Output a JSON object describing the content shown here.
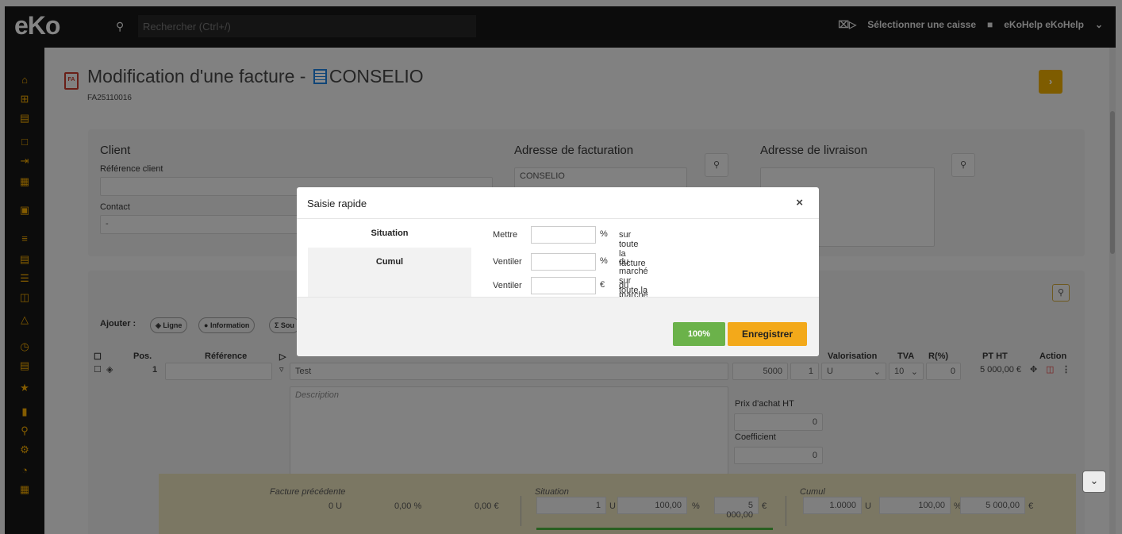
{
  "topbar": {
    "logo": "eKo",
    "search_placeholder": "Rechercher (Ctrl+/)",
    "cash_label": "Sélectionner une caisse",
    "user_label": "eKoHelp eKoHelp"
  },
  "page": {
    "title": "Modification d'une facture - ",
    "title_company": "CONSELIO",
    "subtitle": "FA25110016",
    "doc_badge": "FA"
  },
  "client": {
    "heading": "Client",
    "ref_label": "Référence client",
    "ref_value": "",
    "contact_label": "Contact",
    "contact_value": "-"
  },
  "billing": {
    "heading": "Adresse de facturation",
    "value": "CONSELIO"
  },
  "delivery": {
    "heading": "Adresse de livraison",
    "value": ""
  },
  "lines": {
    "add_label": "Ajouter :",
    "add_buttons": [
      "Ligne",
      "Information",
      "Sou"
    ],
    "columns": {
      "pos": "Pos.",
      "reference": "Référence",
      "valorisation": "Valorisation",
      "tva": "TVA",
      "r": "R(%)",
      "pt_ht": "PT HT",
      "action": "Action"
    },
    "row": {
      "pos": "1",
      "designation": "Test",
      "pu": "5000",
      "qty": "1",
      "unit": "U",
      "tva": "10",
      "r": "0",
      "pt_ht": "5 000,00 €",
      "description_placeholder": "Description",
      "purchase_label": "Prix d'achat HT",
      "purchase_value": "0",
      "coef_label": "Coefficient",
      "coef_value": "0"
    }
  },
  "summary": {
    "prev_label": "Facture précédente",
    "prev_qty": "0 U",
    "prev_pct": "0,00 %",
    "prev_amount": "0,00 €",
    "situation_label": "Situation",
    "situation_qty": "1",
    "situation_unit": "U",
    "situation_pct": "100,00",
    "situation_amount": "5 000,00",
    "cumul_label": "Cumul",
    "cumul_qty": "1.0000",
    "cumul_unit": "U",
    "cumul_pct": "100,00",
    "cumul_amount": "5 000,00",
    "pct_sym": "%",
    "eur_sym": "€"
  },
  "modal": {
    "title": "Saisie rapide",
    "close": "×",
    "tabs": [
      "Situation",
      "Cumul"
    ],
    "rows": [
      {
        "pre": "Mettre",
        "unit": "%",
        "post": "sur toute la facture"
      },
      {
        "pre": "Ventiler",
        "unit": "%",
        "post": "du marché sur toute la facture"
      },
      {
        "pre": "Ventiler",
        "unit": "€",
        "post": "du marché sur toute la facture"
      }
    ],
    "btn_100": "100%",
    "btn_save": "Enregistrer"
  }
}
